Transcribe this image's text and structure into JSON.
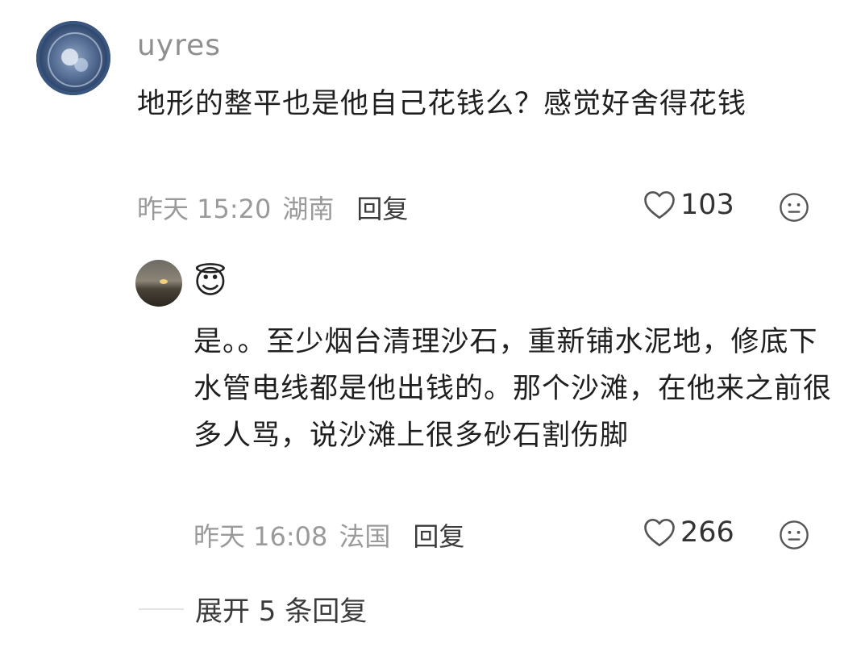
{
  "comment": {
    "username": "uyres",
    "text": "地形的整平也是他自己花钱么？感觉好舍得花钱",
    "time": "昨天 15:20",
    "location": "湖南",
    "reply_label": "回复",
    "likes": "103",
    "like_icon": "heart-outline-icon",
    "dislike_icon": "neutral-face-icon"
  },
  "reply": {
    "username_emoji": "😇",
    "text": "是。。至少烟台清理沙石，重新铺水泥地，修底下水管电线都是他出钱的。那个沙滩，在他来之前很多人骂，说沙滩上很多砂石割伤脚",
    "time": "昨天 16:08",
    "location": "法国",
    "reply_label": "回复",
    "likes": "266",
    "like_icon": "heart-outline-icon",
    "dislike_icon": "neutral-face-icon"
  },
  "expand_replies": "展开 5 条回复"
}
